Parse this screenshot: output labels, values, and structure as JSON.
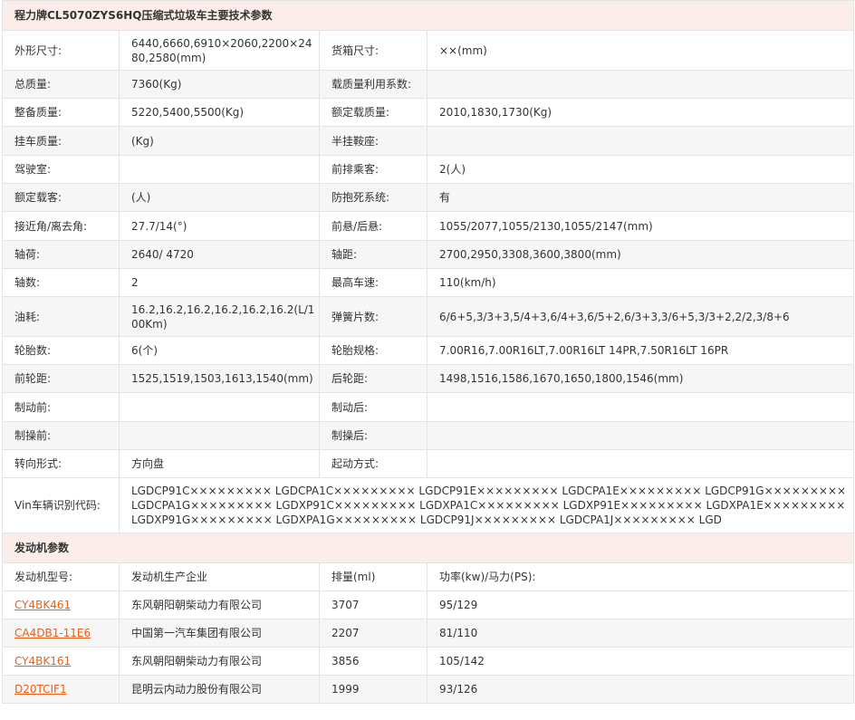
{
  "spec_section": {
    "title": "程力牌CL5070ZYS6HQ压缩式垃圾车主要技术参数",
    "rows": [
      [
        [
          "外形尺寸:",
          "6440,6660,6910×2060,2200×2480,2580(mm)"
        ],
        [
          "货箱尺寸:",
          "××(mm)"
        ]
      ],
      [
        [
          "总质量:",
          "7360(Kg)"
        ],
        [
          "载质量利用系数:",
          ""
        ]
      ],
      [
        [
          "整备质量:",
          "5220,5400,5500(Kg)"
        ],
        [
          "额定载质量:",
          "2010,1830,1730(Kg)"
        ]
      ],
      [
        [
          "挂车质量:",
          "(Kg)"
        ],
        [
          "半挂鞍座:",
          ""
        ]
      ],
      [
        [
          "驾驶室:",
          ""
        ],
        [
          "前排乘客:",
          "2(人)"
        ]
      ],
      [
        [
          "额定载客:",
          "(人)"
        ],
        [
          "防抱死系统:",
          "有"
        ]
      ],
      [
        [
          "接近角/离去角:",
          "27.7/14(°)"
        ],
        [
          "前悬/后悬:",
          "1055/2077,1055/2130,1055/2147(mm)"
        ]
      ],
      [
        [
          "轴荷:",
          "2640/ 4720"
        ],
        [
          "轴距:",
          "2700,2950,3308,3600,3800(mm)"
        ]
      ],
      [
        [
          "轴数:",
          "2"
        ],
        [
          "最高车速:",
          "110(km/h)"
        ]
      ],
      [
        [
          "油耗:",
          "16.2,16.2,16.2,16.2,16.2,16.2(L/100Km)"
        ],
        [
          "弹簧片数:",
          "6/6+5,3/3+3,5/4+3,6/4+3,6/5+2,6/3+3,3/6+5,3/3+2,2/2,3/8+6"
        ]
      ],
      [
        [
          "轮胎数:",
          "6(个)"
        ],
        [
          "轮胎规格:",
          "7.00R16,7.00R16LT,7.00R16LT 14PR,7.50R16LT 16PR"
        ]
      ],
      [
        [
          "前轮距:",
          "1525,1519,1503,1613,1540(mm)"
        ],
        [
          "后轮距:",
          "1498,1516,1586,1670,1650,1800,1546(mm)"
        ]
      ],
      [
        [
          "制动前:",
          ""
        ],
        [
          "制动后:",
          ""
        ]
      ],
      [
        [
          "制操前:",
          ""
        ],
        [
          "制操后:",
          ""
        ]
      ],
      [
        [
          "转向形式:",
          "方向盘"
        ],
        [
          "起动方式:",
          ""
        ]
      ]
    ],
    "vin": {
      "label": "Vin车辆识别代码:",
      "value": "LGDCP91C××××××××× LGDCPA1C××××××××× LGDCP91E××××××××× LGDCPA1E××××××××× LGDCP91G××××××××× LGDCPA1G××××××××× LGDXP91C××××××××× LGDXPA1C××××××××× LGDXP91E××××××××× LGDXPA1E××××××××× LGDXP91G××××××××× LGDXPA1G××××××××× LGDCP91J××××××××× LGDCPA1J××××××××× LGD"
    }
  },
  "engine_section": {
    "title": "发动机参数",
    "headers": [
      "发动机型号:",
      "发动机生产企业",
      "排量(ml)",
      "功率(kw)/马力(PS):"
    ],
    "rows": [
      {
        "model": "CY4BK461",
        "maker": "东风朝阳朝柴动力有限公司",
        "displacement": "3707",
        "power": "95/129"
      },
      {
        "model": "CA4DB1-11E6",
        "maker": "中国第一汽车集团有限公司",
        "displacement": "2207",
        "power": "81/110"
      },
      {
        "model": "CY4BK161",
        "maker": "东风朝阳朝柴动力有限公司",
        "displacement": "3856",
        "power": "105/142"
      },
      {
        "model": "D20TCIF1",
        "maker": "昆明云内动力股份有限公司",
        "displacement": "1999",
        "power": "93/126"
      }
    ]
  },
  "colors": {
    "section_bg": "#fbeeea",
    "stripe_bg": "#f6f6f6",
    "link": "#e8611a",
    "border": "#e4e4e4"
  }
}
